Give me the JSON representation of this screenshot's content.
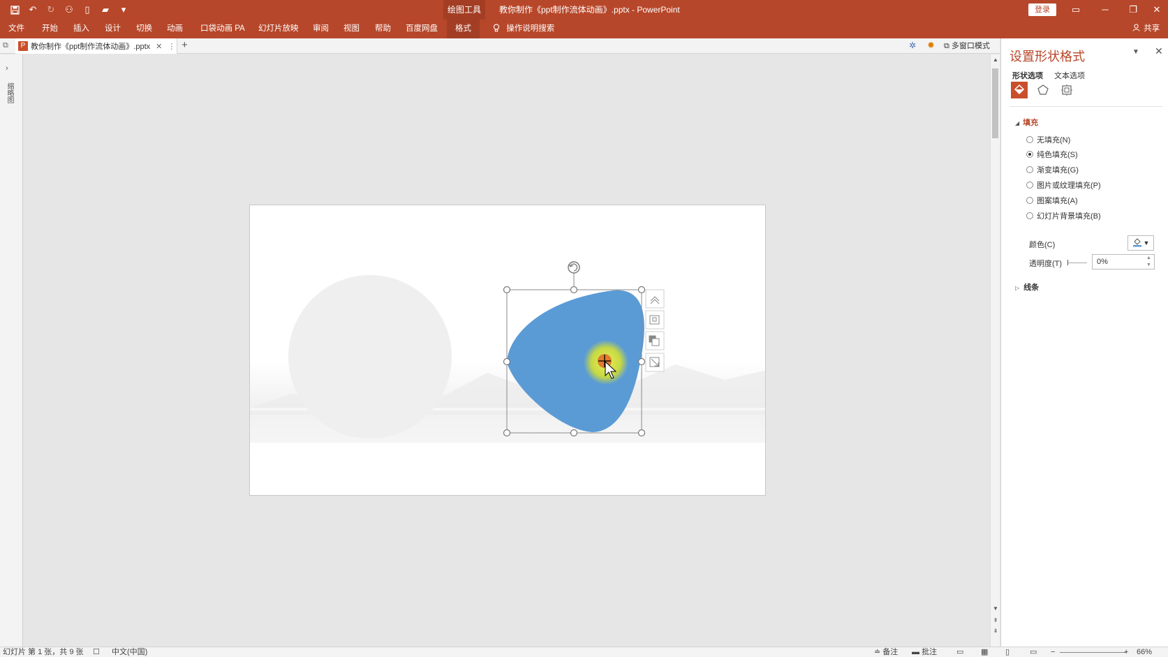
{
  "window": {
    "context_tool_label": "绘图工具",
    "title": "教你制作《ppt制作流体动画》.pptx  -  PowerPoint",
    "login_label": "登录",
    "restore_label": "▭",
    "minimize_label": "─",
    "maximize_label": "❐",
    "close_label": "✕"
  },
  "ribbon": {
    "tabs": [
      "文件",
      "开始",
      "插入",
      "设计",
      "切换",
      "动画",
      "口袋动画 PA",
      "幻灯片放映",
      "审阅",
      "视图",
      "帮助",
      "百度网盘",
      "格式"
    ],
    "active_tab": "格式",
    "tell_me": "操作说明搜索",
    "share": "共享"
  },
  "doc_tab": {
    "label": "教你制作《ppt制作流体动画》.pptx",
    "close": "✕",
    "more": "⋮",
    "add": "+",
    "multi_window": "多窗口模式"
  },
  "thumbnail_panel": {
    "label": "缩略图"
  },
  "format_pane": {
    "title": "设置形状格式",
    "tabs": [
      "形状选项",
      "文本选项"
    ],
    "fill_section": "填充",
    "fill_options": [
      {
        "label": "无填充(N)",
        "selected": false
      },
      {
        "label": "纯色填充(S)",
        "selected": true
      },
      {
        "label": "渐变填充(G)",
        "selected": false
      },
      {
        "label": "图片或纹理填充(P)",
        "selected": false
      },
      {
        "label": "图案填充(A)",
        "selected": false
      },
      {
        "label": "幻灯片背景填充(B)",
        "selected": false
      }
    ],
    "color_label": "颜色(C)",
    "transparency_label": "透明度(T)",
    "transparency_value": "0%",
    "line_section": "线条"
  },
  "status_bar": {
    "slide_info": "幻灯片 第 1 张，共 9 张",
    "language": "中文(中国)",
    "notes": "备注",
    "comments": "批注",
    "zoom": "66%"
  },
  "colors": {
    "accent": "#b7472a",
    "shape_fill": "#5b9bd5",
    "cursor_highlight": "#d4e04a"
  }
}
